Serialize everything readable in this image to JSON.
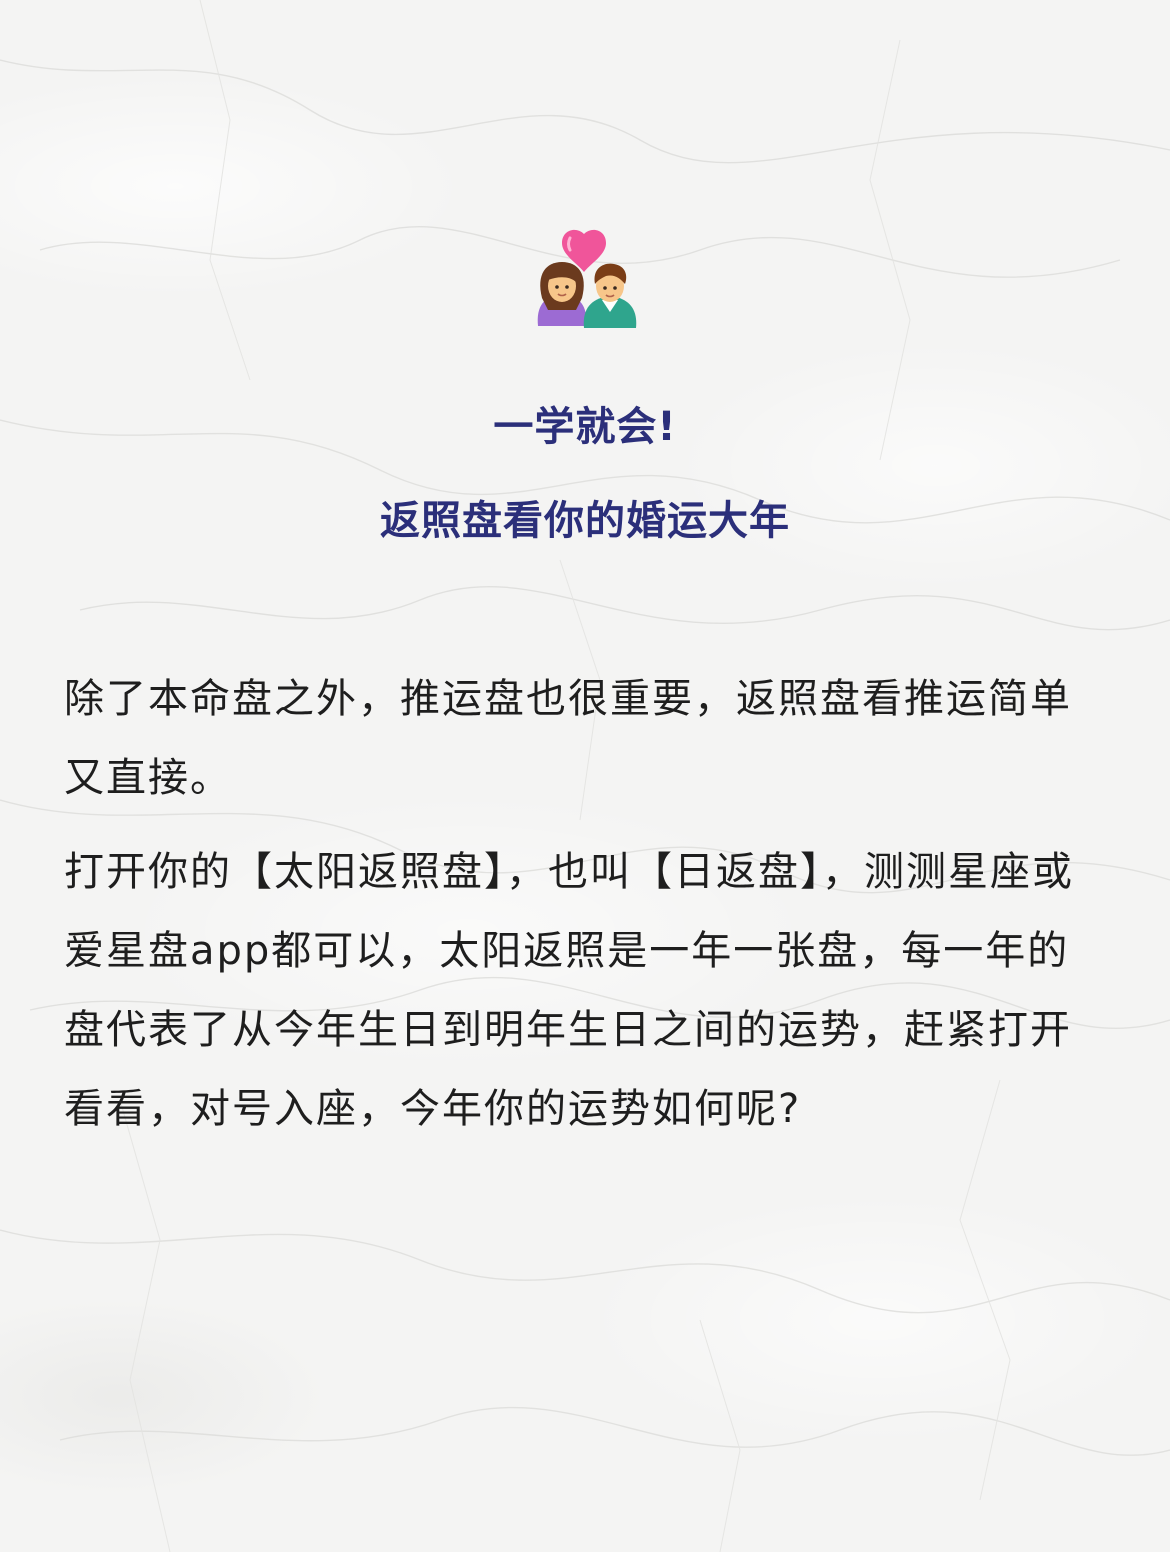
{
  "header": {
    "icon": "couple-with-heart-icon",
    "title_line1": "一学就会!",
    "title_line2": "返照盘看你的婚运大年"
  },
  "body": {
    "paragraph1": "除了本命盘之外，推运盘也很重要，返照盘看推运简单又直接。",
    "paragraph2": "打开你的【太阳返照盘】，也叫【日返盘】，测测星座或爱星盘app都可以，太阳返照是一年一张盘，每一年的盘代表了从今年生日到明年生日之间的运势，赶紧打开看看，对号入座，今年你的运势如何呢?"
  },
  "colors": {
    "title": "#2b2f7a",
    "text": "#1e1e1e",
    "background": "#f4f4f3",
    "heart": "#f0559a"
  }
}
